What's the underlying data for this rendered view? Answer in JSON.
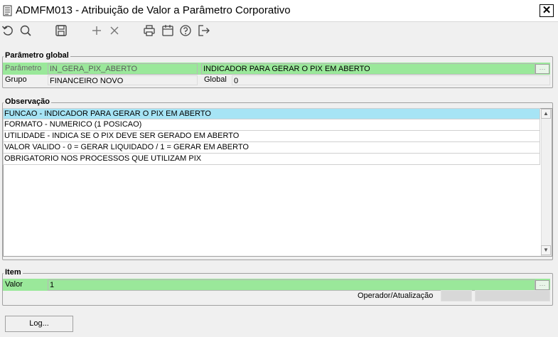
{
  "window": {
    "title": "ADMFM013 - Atribuição de Valor a Parâmetro Corporativo",
    "close": "✕"
  },
  "toolbar": {
    "icons": [
      "undo-icon",
      "search-icon",
      "save-icon",
      "add-icon",
      "delete-icon",
      "print-icon",
      "calendar-icon",
      "help-icon",
      "exit-icon"
    ]
  },
  "parametro_global": {
    "title": "Parâmetro global",
    "parametro_label": "Parâmetro",
    "parametro_value": "IN_GERA_PIX_ABERTO",
    "descricao_value": "INDICADOR PARA GERAR O PIX EM ABERTO",
    "grupo_label": "Grupo",
    "grupo_value": "FINANCEIRO NOVO",
    "global_label": "Global",
    "global_value": "0"
  },
  "observacao": {
    "title": "Observação",
    "lines": [
      "FUNCAO - INDICADOR PARA GERAR O PIX EM ABERTO",
      "FORMATO - NUMERICO (1 POSICAO)",
      "UTILIDADE - INDICA SE O PIX DEVE SER GERADO EM ABERTO",
      "VALOR VALIDO - 0 = GERAR LIQUIDADO  / 1 = GERAR EM ABERTO",
      "OBRIGATORIO NOS PROCESSOS QUE UTILIZAM PIX"
    ]
  },
  "item": {
    "title": "Item",
    "valor_label": "Valor",
    "valor_value": "1",
    "operador_label": "Operador/Atualização"
  },
  "buttons": {
    "log": "Log..."
  },
  "colors": {
    "field_green": "#9ae89a",
    "selection": "#a6e4f5"
  }
}
